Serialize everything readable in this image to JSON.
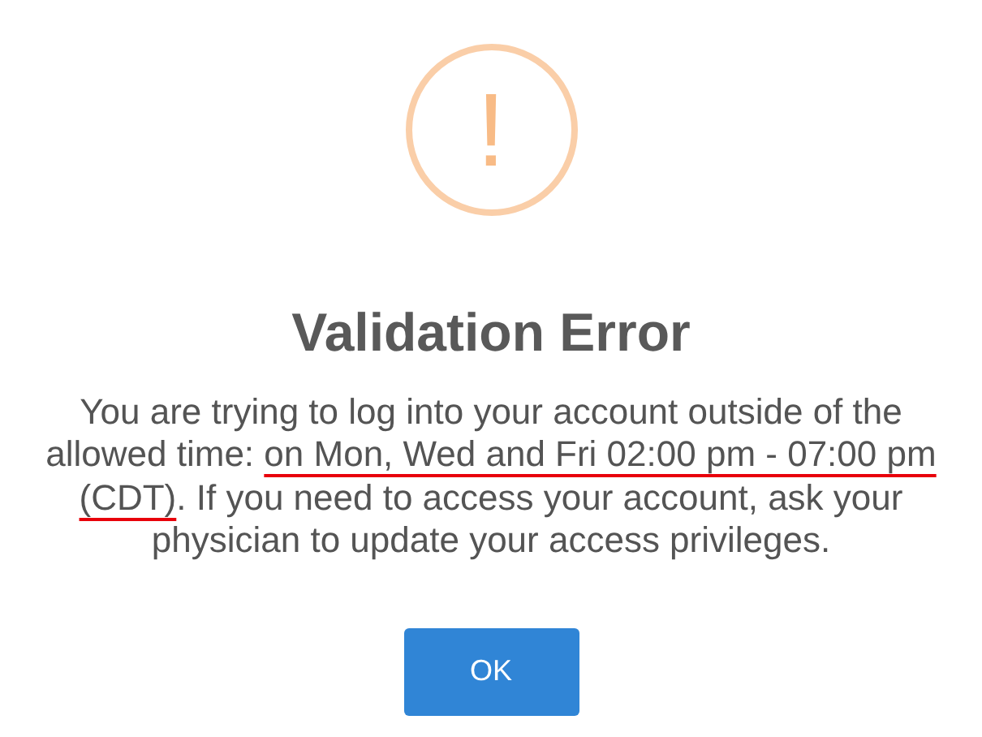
{
  "dialog": {
    "icon": "!",
    "title": "Validation Error",
    "message": [
      {
        "text": "You are trying to log into your account outside of the allowed time: ",
        "underlined": false
      },
      {
        "text": "on Mon, Wed and Fri 02:00 pm - 07:00 pm (CDT)",
        "underlined": true
      },
      {
        "text": ". If you need to access your account, ask your physician to update your access privileges.",
        "underlined": false
      }
    ],
    "button": "OK"
  }
}
